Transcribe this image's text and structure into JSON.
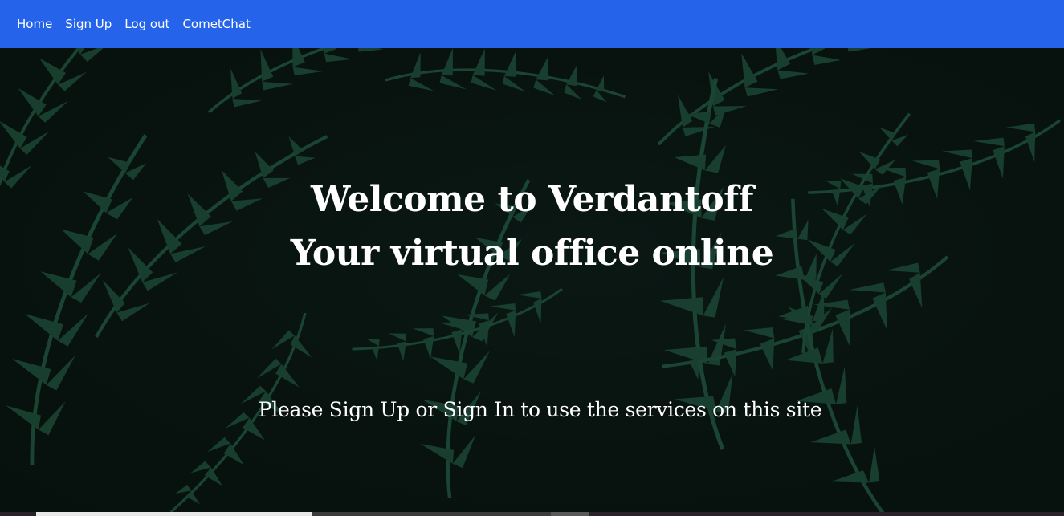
{
  "nav": {
    "items": [
      {
        "label": "Home"
      },
      {
        "label": "Sign Up"
      },
      {
        "label": "Log out"
      },
      {
        "label": "CometChat"
      }
    ],
    "background_color": "#2563eb"
  },
  "hero": {
    "title_line_1": "Welcome to Verdantoff",
    "title_line_2": "Your virtual office online",
    "subtitle": "Please Sign Up or Sign In to use the services on this site",
    "background_image": "dark-green-fern-leaves"
  }
}
